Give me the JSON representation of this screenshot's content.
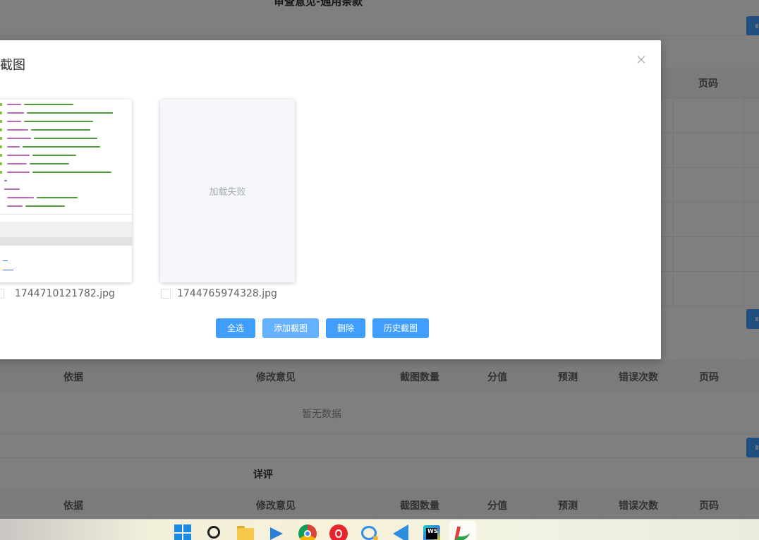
{
  "background": {
    "title": "审查意见-通用条款",
    "table1": {
      "headers": {
        "page": "页码"
      }
    },
    "table2": {
      "headers": {
        "basis": "依据",
        "opinion": "修改意见",
        "count": "截图数量",
        "score": "分值",
        "forecast": "预测",
        "errors": "错误次数",
        "page": "页码"
      },
      "empty_text": "暂无数据"
    },
    "section3": {
      "title": "详评",
      "headers": {
        "basis": "依据",
        "opinion": "修改意见",
        "count": "截图数量",
        "score": "分值",
        "forecast": "预测",
        "errors": "错误次数",
        "page": "页码"
      }
    }
  },
  "dialog": {
    "title": "截图",
    "screenshots": [
      {
        "file_name": "1744710121782.jpg",
        "checked": false,
        "status": "loaded"
      },
      {
        "file_name": "1744765974328.jpg",
        "checked": false,
        "status": "failed",
        "fail_text": "加载失败"
      }
    ],
    "buttons": {
      "select_all": "全选",
      "add": "添加截图",
      "delete": "删除",
      "history": "历史截图"
    },
    "colors": {
      "primary": "#409eff",
      "primary_light": "#66b1ff"
    }
  },
  "taskbar": {
    "icons": [
      "windows-start-icon",
      "search-icon",
      "file-explorer-icon",
      "arrow-app-icon",
      "chrome-icon",
      "netease-music-icon",
      "chat-icon",
      "vscode-icon",
      "webstorm-icon",
      "custom-app-icon"
    ]
  }
}
